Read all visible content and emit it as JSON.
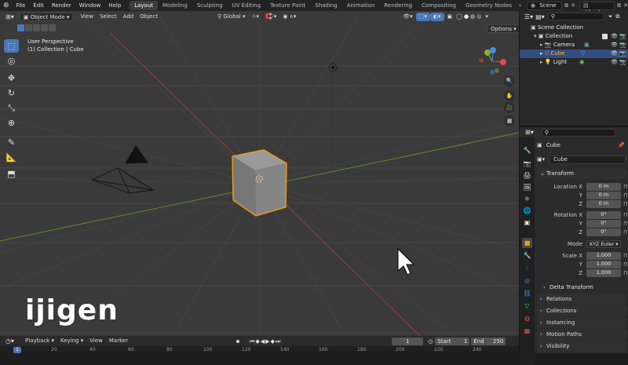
{
  "menu": [
    "File",
    "Edit",
    "Render",
    "Window",
    "Help"
  ],
  "workspaces": [
    "Layout",
    "Modeling",
    "Sculpting",
    "UV Editing",
    "Texture Paint",
    "Shading",
    "Animation",
    "Rendering",
    "Compositing",
    "Geometry Nodes"
  ],
  "scene_name": "Scene",
  "view_layer": "ViewLayer",
  "viewport": {
    "mode": "Object Mode",
    "menus": [
      "View",
      "Select",
      "Add",
      "Object"
    ],
    "transform_orientation": "Global",
    "overlay_line1": "User Perspective",
    "overlay_line2": "(1) Collection | Cube",
    "options_label": "Options"
  },
  "outliner": {
    "root": "Scene Collection",
    "collection": "Collection",
    "items": [
      "Camera",
      "Cube",
      "Light"
    ],
    "selected": "Cube"
  },
  "properties": {
    "object_name": "Cube",
    "datablock_name": "Cube",
    "transform_label": "Transform",
    "location_label": "Location X",
    "rotation_label": "Rotation X",
    "scale_label": "Scale X",
    "axis_y": "Y",
    "axis_z": "Z",
    "location": [
      "0 m",
      "0 m",
      "0 m"
    ],
    "rotation": [
      "0°",
      "0°",
      "0°"
    ],
    "scale": [
      "1.000",
      "1.000",
      "1.000"
    ],
    "mode_label": "Mode",
    "mode_value": "XYZ Euler",
    "delta_label": "Delta Transform",
    "sections": [
      "Relations",
      "Collections",
      "Instancing",
      "Motion Paths",
      "Visibility"
    ]
  },
  "timeline": {
    "menus": [
      "Playback",
      "Keying",
      "View",
      "Marker"
    ],
    "current_frame": "1",
    "start_label": "Start",
    "start_value": "1",
    "end_label": "End",
    "end_value": "250",
    "ruler_ticks": [
      "1",
      "20",
      "40",
      "60",
      "80",
      "100",
      "120",
      "140",
      "160",
      "180",
      "200",
      "220",
      "240"
    ],
    "playhead_frame": 1
  },
  "watermark": "ijigen",
  "colors": {
    "accent": "#4a77b8",
    "selected_outline": "#f39c12",
    "x_axis": "#9a3a40",
    "y_axis": "#6b8a2a"
  }
}
